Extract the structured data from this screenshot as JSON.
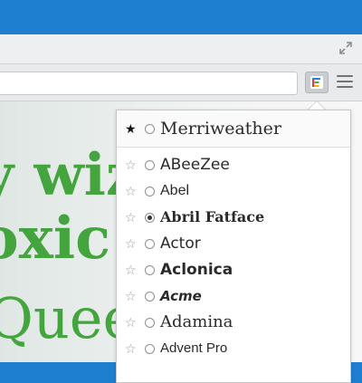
{
  "background_text": {
    "line1": "y wiz",
    "line2": "oxic b",
    "line3": "Quee"
  },
  "popup": {
    "current": {
      "name": "Merriweather",
      "starred": true,
      "selected": false
    },
    "fonts": [
      {
        "name": "ABeeZee",
        "starred": false,
        "selected": false
      },
      {
        "name": "Abel",
        "starred": false,
        "selected": false
      },
      {
        "name": "Abril Fatface",
        "starred": false,
        "selected": true
      },
      {
        "name": "Actor",
        "starred": false,
        "selected": false
      },
      {
        "name": "Aclonica",
        "starred": false,
        "selected": false
      },
      {
        "name": "Acme",
        "starred": false,
        "selected": false
      },
      {
        "name": "Adamina",
        "starred": false,
        "selected": false
      },
      {
        "name": "Advent Pro",
        "starred": false,
        "selected": false
      }
    ]
  },
  "icons": {
    "extension": "font-changer-icon",
    "menu": "hamburger-menu-icon",
    "expand": "expand-window-icon"
  },
  "colors": {
    "accent_green": "#44a53f",
    "window_blue": "#1e7fd0"
  }
}
